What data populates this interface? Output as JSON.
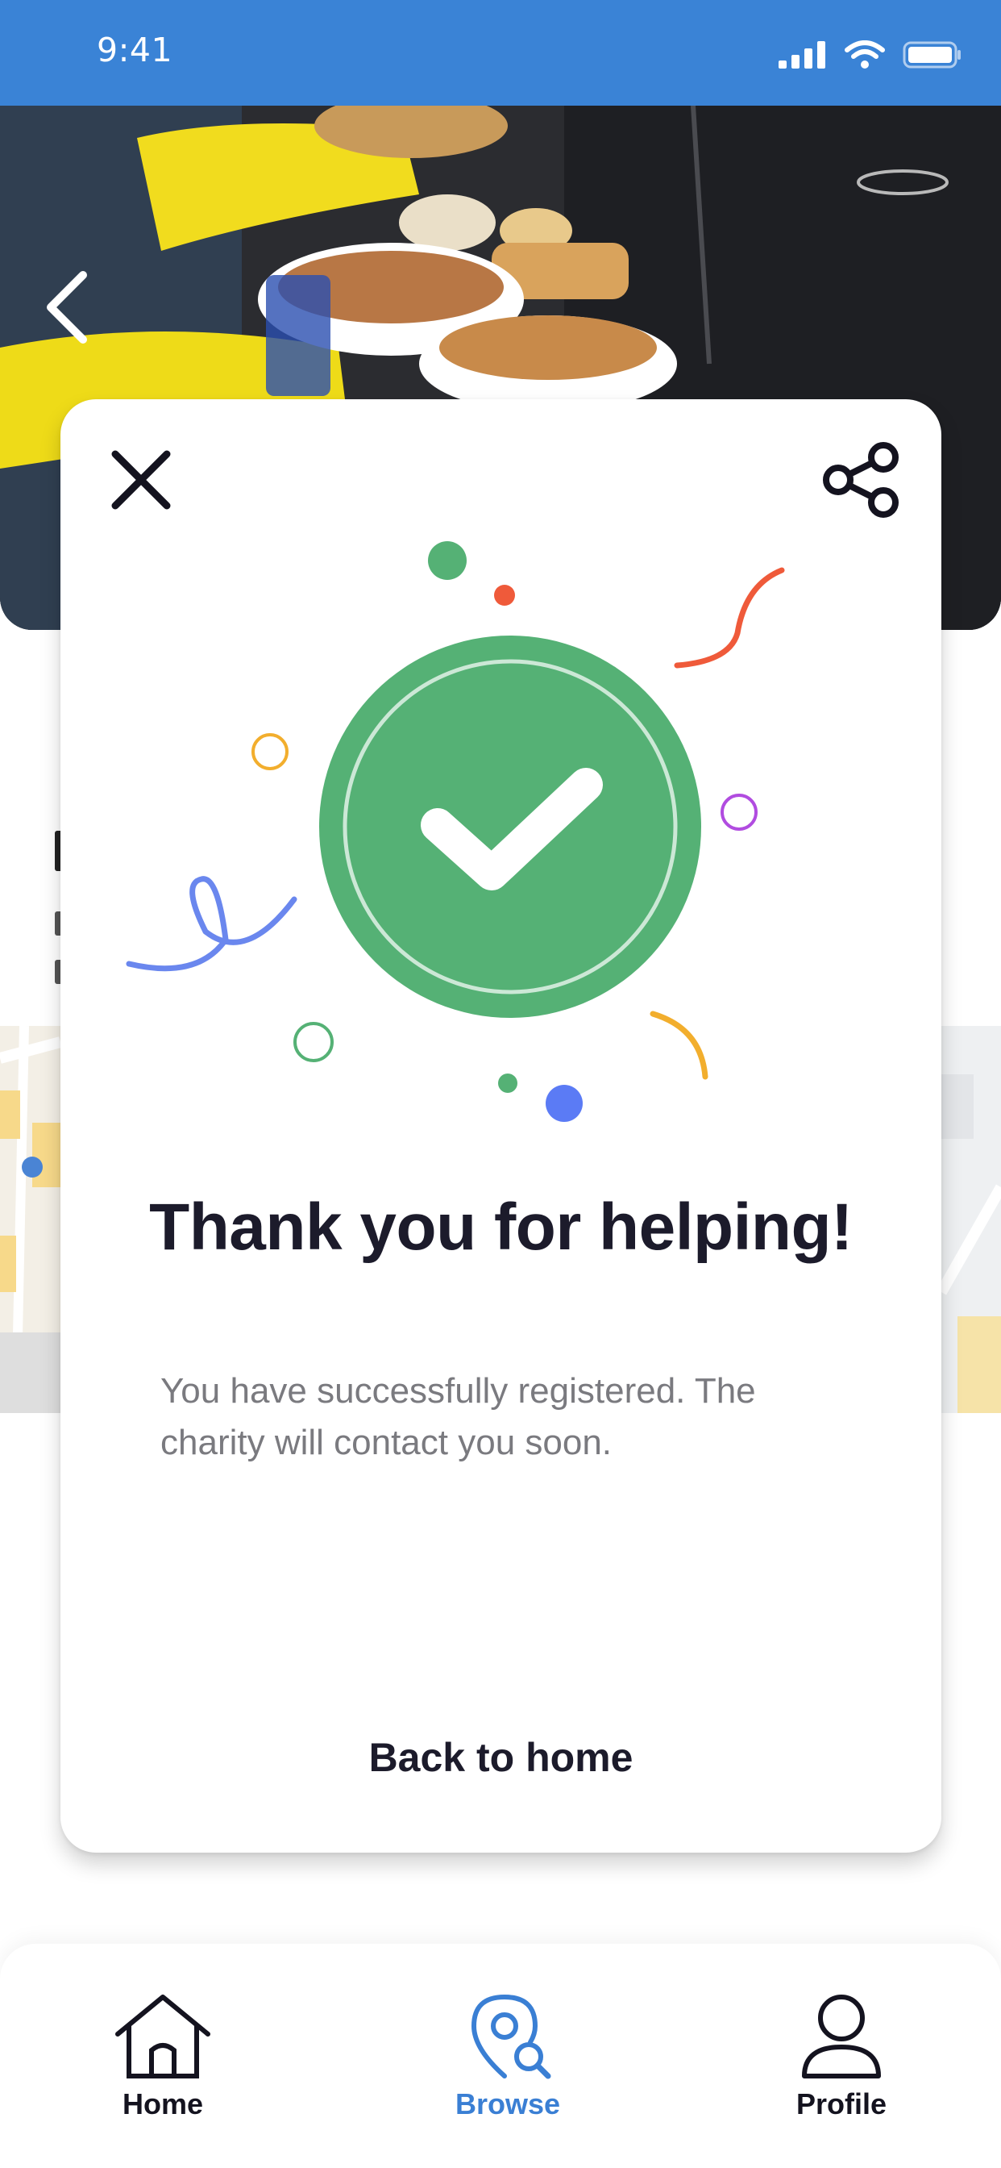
{
  "status_bar": {
    "time": "9:41"
  },
  "modal": {
    "title": "Thank you for helping!",
    "message": "You have successfully registered. The charity will contact you soon.",
    "back_home_label": "Back to home"
  },
  "bottom_nav": {
    "items": [
      {
        "label": "Home",
        "icon": "home-icon",
        "active": false
      },
      {
        "label": "Browse",
        "icon": "map-pin-search-icon",
        "active": true
      },
      {
        "label": "Profile",
        "icon": "person-icon",
        "active": false
      }
    ]
  },
  "colors": {
    "status_bar": "#3a83d6",
    "success_green": "#55b175",
    "active_nav": "#3a7fd4",
    "text_dark": "#1c1b2b",
    "text_muted": "#7a7a7f"
  }
}
